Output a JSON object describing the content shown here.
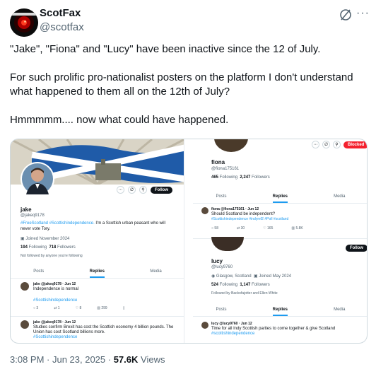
{
  "tweet": {
    "display_name": "ScotFax",
    "handle": "@scotfax",
    "text": "\"Jake\", \"Fiona\" and \"Lucy\" have been inactive since the 12 of July.\n\nFor such prolific pro-nationalist posters on the platform I don't understand what happened to them all on the 12th of July?\n\nHmmmmm.... now what could have happened.",
    "time": "3:08 PM · Jun 23, 2025 · ",
    "views_count": "57.6K",
    "views_label": " Views"
  },
  "jake": {
    "name": "jake",
    "handle": "@jakeq9178",
    "bio_tags": "#FreeScotland #Scottishindependence.",
    "bio": " I'm a Scottish urban peasant who will never vote Tory.",
    "joined": "Joined November 2024",
    "following_count": "194",
    "following_label": " Following",
    "followers_count": "718",
    "followers_label": " Followers",
    "not_followed": "Not followed by anyone you're following",
    "follow_label": "Follow",
    "tabs": [
      "Posts",
      "Replies",
      "Media"
    ],
    "post1": {
      "header": "jake @jakeq9178 · Jun 12",
      "text": "Independence is normal",
      "tag": "#Scottishindependence",
      "actions": [
        "3",
        "1",
        "8",
        "299"
      ]
    },
    "post2": {
      "header": "jake @jakeq9178 · Jun 12",
      "text": "Studies confirm Brexit has cost the Scottish economy 4 billion pounds. The Union has cost Scotland billions more.",
      "tag": "#Scottishindependence"
    }
  },
  "fiona": {
    "name": "fiona",
    "handle": "@fiona175161",
    "following_count": "465",
    "following_label": " Following",
    "followers_count": "2,247",
    "followers_label": " Followers",
    "blocked_label": "Blocked",
    "tabs": [
      "Posts",
      "Replies",
      "Media"
    ],
    "post": {
      "header": "fiona @fiona175161 · Jun 12",
      "text": "Should Scotland be independent?",
      "tags": "#Scottishindependence #indyref2 #Poll #scotland",
      "actions": [
        "58",
        "30",
        "165",
        "5.8K"
      ]
    }
  },
  "lucy": {
    "name": "lucy",
    "handle": "@lucy9760",
    "location": "Glasgow, Scotland",
    "joined": "Joined May 2024",
    "following_count": "524",
    "following_label": " Following",
    "followers_count": "1,147",
    "followers_label": " Followers",
    "followed_by": "Followed by Backofajotter and Ellen White",
    "follow_label": "Follow",
    "tabs": [
      "Posts",
      "Replies",
      "Media"
    ],
    "post": {
      "header": "lucy @lucy9760 · Jun 12",
      "text": "Time for all Indy Scottish parties to come together & give Scotland",
      "tag": "#scottishindependence"
    }
  },
  "colors": {
    "accent": "#1d9bf0",
    "blocked": "#f4212e",
    "text": "#0f1419",
    "muted": "#536471"
  },
  "icons": [
    "hal-avatar-icon",
    "grok-icon",
    "more-icon",
    "share-icon",
    "search-icon",
    "reply-icon",
    "repost-icon",
    "like-icon",
    "views-icon",
    "bookmark-icon",
    "location-icon",
    "calendar-icon"
  ]
}
